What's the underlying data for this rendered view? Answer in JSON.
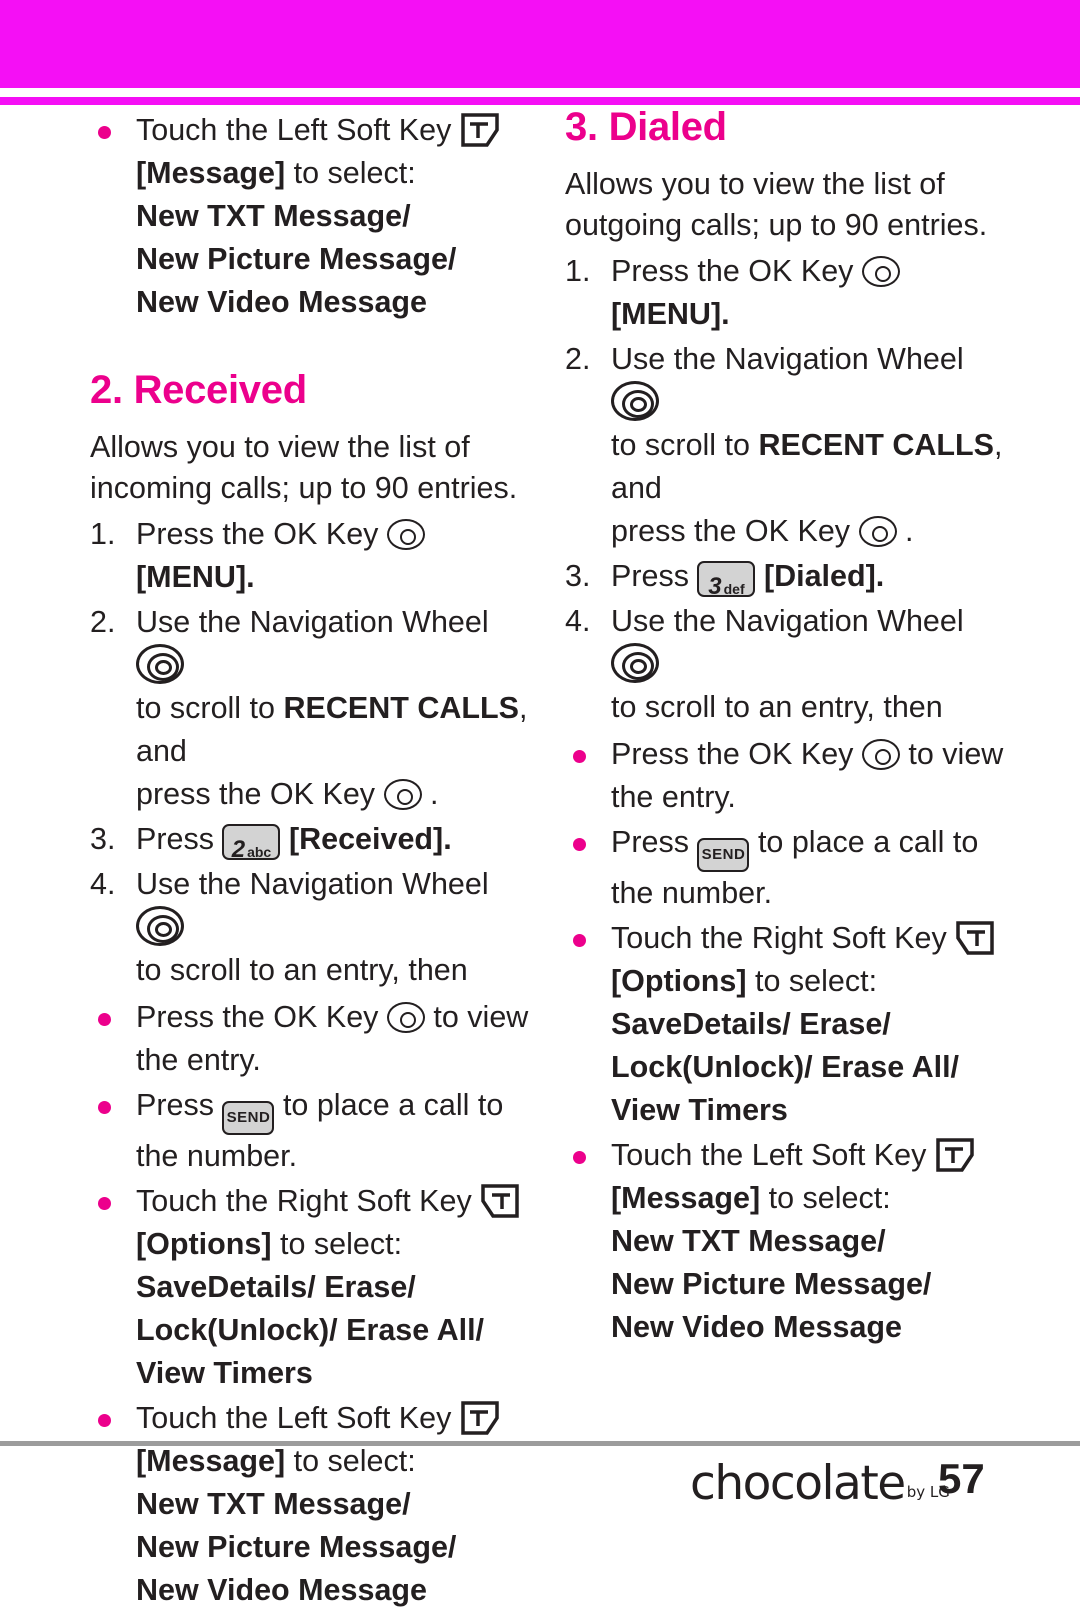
{
  "page": {
    "number": "57",
    "brand": "chocolate",
    "brand_sub": "by LG"
  },
  "left_column": {
    "top_bullets": [
      {
        "prefix": "Touch the Left Soft Key",
        "icon": "left-soft-key-icon",
        "line2_bracket": "[Message]",
        "line2_rest": " to select:",
        "options": [
          "New TXT Message/",
          "New Picture Message/",
          "New Video Message"
        ]
      }
    ],
    "section": {
      "heading": "2. Received",
      "intro": "Allows you to view the list of incoming calls; up to 90 entries.",
      "steps": [
        {
          "num": "1.",
          "text_before": "Press the OK Key",
          "icon": "ok-key-icon",
          "text_after": "[MENU]."
        },
        {
          "num": "2.",
          "text_before": "Use the Navigation Wheel",
          "icon": "navigation-wheel-icon",
          "line2_before": "to scroll to ",
          "line2_bold": "RECENT CALLS",
          "line2_after": ", and",
          "line3_before": "press the OK Key",
          "line3_icon": "ok-key-icon",
          "line3_after": "."
        },
        {
          "num": "3.",
          "text_before": "Press",
          "key_digit": "2",
          "key_letters": "abc",
          "text_after": "[Received]."
        },
        {
          "num": "4.",
          "text_before": "Use the Navigation Wheel",
          "icon": "navigation-wheel-icon",
          "line2": "to scroll to an entry, then"
        }
      ],
      "bullets": [
        {
          "before": "Press the OK Key",
          "icon": "ok-key-icon",
          "after": "to view",
          "line2": "the entry."
        },
        {
          "before": "Press",
          "icon": "send-key-icon",
          "after": "to place a call to",
          "line2": "the number."
        },
        {
          "before": "Touch the Right Soft Key",
          "icon": "right-soft-key-icon",
          "line2_bracket": "[Options]",
          "line2_rest": " to select:",
          "options": [
            "SaveDetails/ Erase/",
            "Lock(Unlock)/ Erase All/",
            "View Timers"
          ]
        },
        {
          "before": "Touch the Left Soft Key",
          "icon": "left-soft-key-icon",
          "line2_bracket": "[Message]",
          "line2_rest": " to select:",
          "options": [
            "New TXT Message/",
            "New Picture Message/",
            "New Video Message"
          ]
        }
      ]
    }
  },
  "right_column": {
    "section": {
      "heading": "3. Dialed",
      "intro": "Allows you to view the list of outgoing calls; up to 90 entries.",
      "steps": [
        {
          "num": "1.",
          "text_before": "Press the OK Key",
          "icon": "ok-key-icon",
          "text_after": "[MENU]."
        },
        {
          "num": "2.",
          "text_before": "Use the Navigation Wheel",
          "icon": "navigation-wheel-icon",
          "line2_before": "to scroll to ",
          "line2_bold": "RECENT CALLS",
          "line2_after": ", and",
          "line3_before": "press the OK Key",
          "line3_icon": "ok-key-icon",
          "line3_after": "."
        },
        {
          "num": "3.",
          "text_before": "Press",
          "key_digit": "3",
          "key_letters": "def",
          "text_after": "[Dialed]."
        },
        {
          "num": "4.",
          "text_before": "Use the Navigation Wheel",
          "icon": "navigation-wheel-icon",
          "line2": "to scroll to an entry, then"
        }
      ],
      "bullets": [
        {
          "before": "Press the OK Key",
          "icon": "ok-key-icon",
          "after": "to view",
          "line2": "the entry."
        },
        {
          "before": "Press",
          "icon": "send-key-icon",
          "after": "to place a call to",
          "line2": "the number."
        },
        {
          "before": "Touch the Right Soft Key",
          "icon": "right-soft-key-icon",
          "line2_bracket": "[Options]",
          "line2_rest": " to select:",
          "options": [
            "SaveDetails/ Erase/",
            "Lock(Unlock)/ Erase All/",
            "View Timers"
          ]
        },
        {
          "before": "Touch the Left Soft Key",
          "icon": "left-soft-key-icon",
          "line2_bracket": "[Message]",
          "line2_rest": " to select:",
          "options": [
            "New TXT Message/",
            "New Picture Message/",
            "New Video Message"
          ]
        }
      ]
    }
  },
  "colors": {
    "accent": "#ec008c",
    "band": "#f50ff5",
    "text": "#231f20"
  },
  "icons": {
    "send_label": "SEND",
    "menu_label": "MENU"
  }
}
